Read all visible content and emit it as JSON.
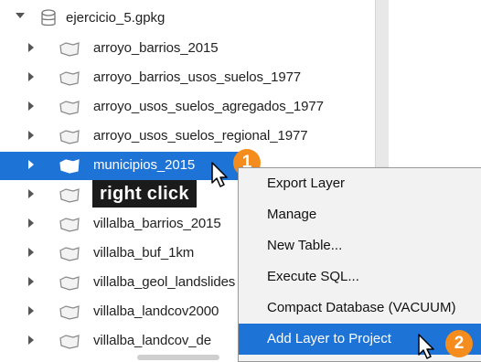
{
  "tree": {
    "root": {
      "label": "ejercicio_5.gpkg"
    },
    "items": [
      {
        "label": "arroyo_barrios_2015"
      },
      {
        "label": "arroyo_barrios_usos_suelos_1977"
      },
      {
        "label": "arroyo_usos_suelos_agregados_1977"
      },
      {
        "label": "arroyo_usos_suelos_regional_1977"
      },
      {
        "label": "municipios_2015",
        "selected": true
      },
      {
        "label": ""
      },
      {
        "label": "villalba_barrios_2015"
      },
      {
        "label": "villalba_buf_1km"
      },
      {
        "label": "villalba_geol_landslides"
      },
      {
        "label": "villalba_landcov2000"
      },
      {
        "label": "villalba_landcov_de"
      }
    ]
  },
  "annotation": {
    "right_click_label": "right click",
    "step1": "1",
    "step2": "2"
  },
  "context_menu": {
    "items": [
      {
        "label": "Export Layer"
      },
      {
        "label": "Manage"
      },
      {
        "label": "New Table..."
      },
      {
        "label": "Execute SQL..."
      },
      {
        "label": "Compact Database (VACUUM)"
      },
      {
        "label": "Add Layer to Project",
        "highlighted": true
      }
    ]
  },
  "colors": {
    "selection": "#1e73d6",
    "badge": "#f58c1e",
    "label_bg": "#1b1b1b"
  }
}
